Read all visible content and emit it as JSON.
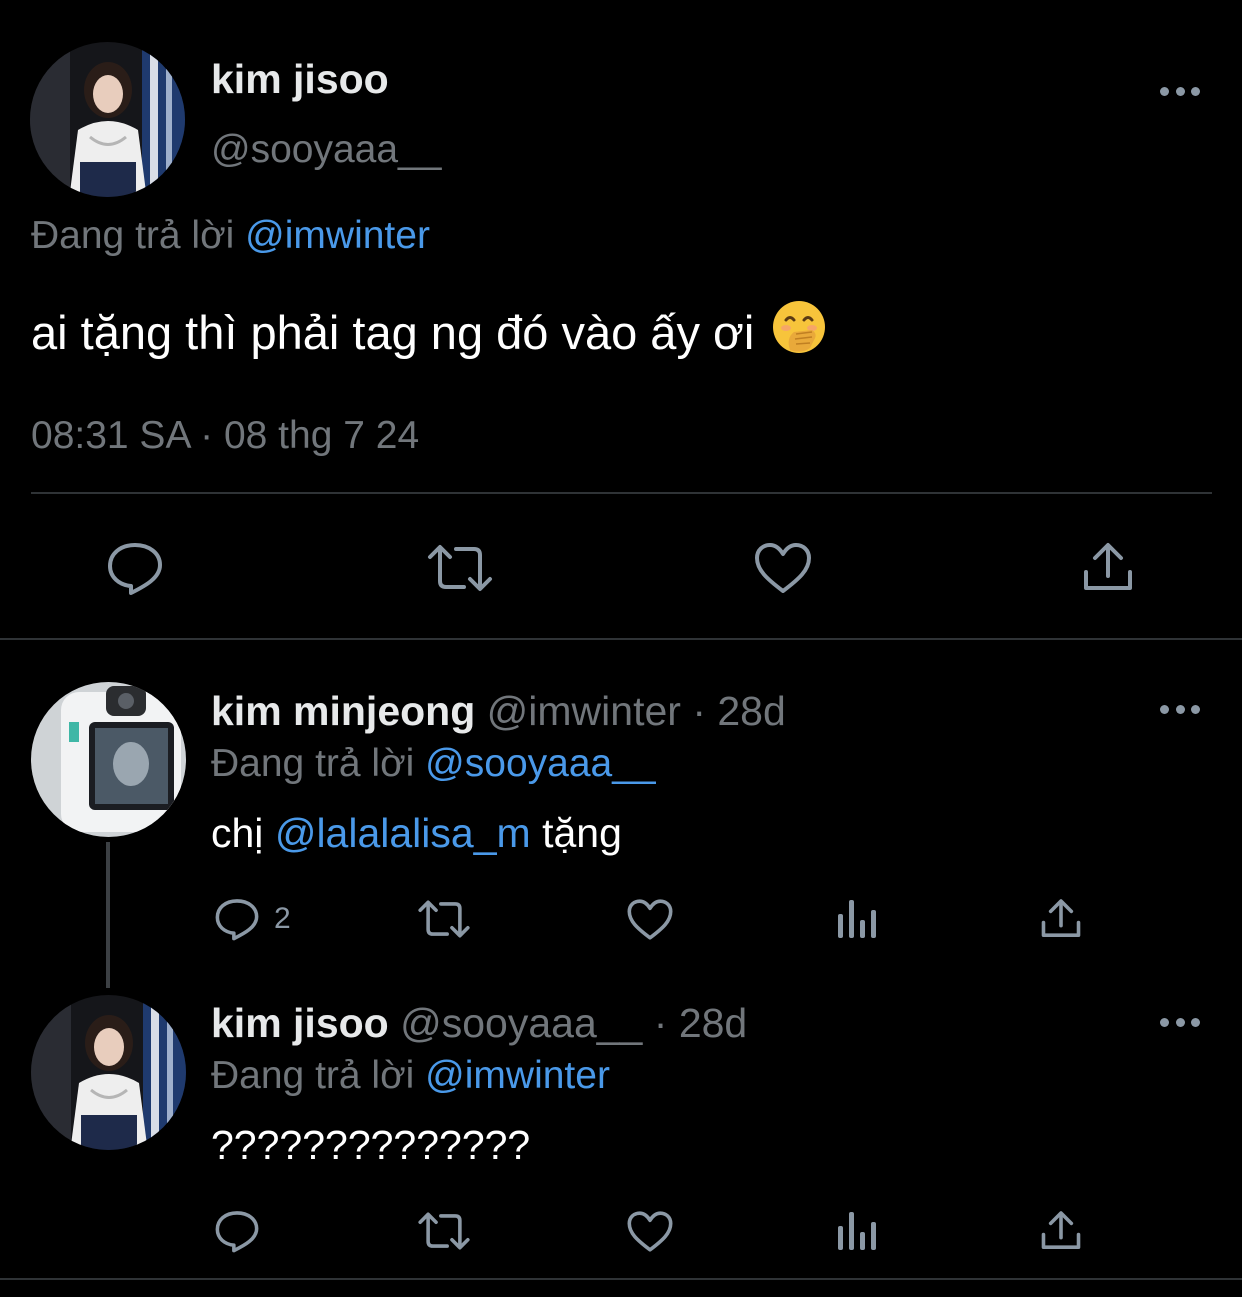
{
  "main_tweet": {
    "author_name": "kim jisoo",
    "author_handle": "@sooyaaa__",
    "replying_prefix": "Đang trả lời",
    "replying_to": "@imwinter",
    "text": "ai tặng thì phải tag ng đó vào ấy ơi",
    "emoji": "face-with-hand-over-mouth-emoji",
    "timestamp": "08:31 SA · 08 thg 7 24"
  },
  "replies": [
    {
      "author_name": "kim minjeong",
      "author_handle": "@imwinter",
      "time_ago": "· 28d",
      "replying_prefix": "Đang trả lời",
      "replying_to": "@sooyaaa__",
      "text_before": "chị",
      "text_mention": "@lalalalisa_m",
      "text_after": "tặng",
      "reply_count": "2"
    },
    {
      "author_name": "kim jisoo",
      "author_handle": "@sooyaaa__",
      "time_ago": "· 28d",
      "replying_prefix": "Đang trả lời",
      "replying_to": "@imwinter",
      "text": "??????????????"
    }
  ],
  "colors": {
    "background": "#000000",
    "text_primary": "#e7e9ea",
    "text_secondary": "#71767b",
    "mention": "#4a99e9",
    "divider": "#2f3336"
  }
}
